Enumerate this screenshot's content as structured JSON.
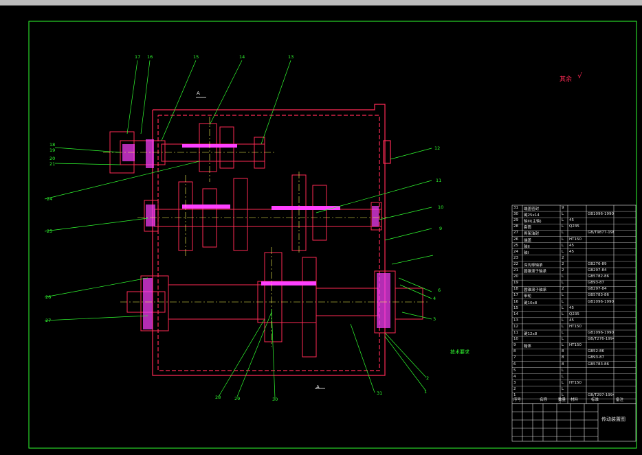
{
  "drawing": {
    "title_cn": "传动装置图",
    "roughness_label": "其余",
    "roughness_symbol": "√",
    "section_label_a_top": "A",
    "section_label_a_bottom": "A",
    "notes_title": "技术要求"
  },
  "callouts": [
    "17",
    "16",
    "15",
    "14",
    "13",
    "12",
    "11",
    "10",
    "9",
    "8",
    "7",
    "6",
    "5",
    "4",
    "3",
    "2",
    "1",
    "18",
    "19",
    "20",
    "21",
    "22",
    "23",
    "24",
    "25",
    "26",
    "27",
    "28",
    "29",
    "30"
  ],
  "table": {
    "headers": [
      "序号",
      "名称",
      "数量",
      "材料",
      "标准",
      "备注"
    ],
    "rows": [
      {
        "no": "31",
        "name": "端盖密封",
        "qty": "9",
        "mat": "",
        "std": ""
      },
      {
        "no": "30",
        "name": "键25x14",
        "qty": "L",
        "mat": "",
        "std": "GB1096-1990"
      },
      {
        "no": "29",
        "name": "轴III(主轴)",
        "qty": "L",
        "mat": "45",
        "std": ""
      },
      {
        "no": "28",
        "name": "套筒",
        "qty": "L",
        "mat": "Q235",
        "std": ""
      },
      {
        "no": "27",
        "name": "骨架油封",
        "qty": "L",
        "mat": "",
        "std": "GB/T9877-1988"
      },
      {
        "no": "26",
        "name": "端盖",
        "qty": "L",
        "mat": "HT150",
        "std": ""
      },
      {
        "no": "25",
        "name": "轴II",
        "qty": "L",
        "mat": "45",
        "std": ""
      },
      {
        "no": "24",
        "name": "轴I",
        "qty": "L",
        "mat": "45",
        "std": ""
      },
      {
        "no": "23",
        "name": "",
        "qty": "2",
        "mat": "",
        "std": ""
      },
      {
        "no": "22",
        "name": "深沟球轴承",
        "qty": "2",
        "mat": "",
        "std": "GB276-89"
      },
      {
        "no": "21",
        "name": "圆锥滚子轴承",
        "qty": "2",
        "mat": "",
        "std": "GB297-84"
      },
      {
        "no": "20",
        "name": "",
        "qty": "L",
        "mat": "",
        "std": "GB5782-86"
      },
      {
        "no": "19",
        "name": "",
        "qty": "L",
        "mat": "",
        "std": "GB93-87"
      },
      {
        "no": "18",
        "name": "圆锥滚子轴承",
        "qty": "2",
        "mat": "",
        "std": "GB297-84"
      },
      {
        "no": "17",
        "name": "带轮",
        "qty": "L",
        "mat": "",
        "std": "GB5783-86"
      },
      {
        "no": "16",
        "name": "键10x8",
        "qty": "L",
        "mat": "",
        "std": "GB1096-1990"
      },
      {
        "no": "15",
        "name": "",
        "qty": "L",
        "mat": "45",
        "std": ""
      },
      {
        "no": "14",
        "name": "",
        "qty": "L",
        "mat": "Q235",
        "std": ""
      },
      {
        "no": "13",
        "name": "",
        "qty": "L",
        "mat": "45",
        "std": ""
      },
      {
        "no": "12",
        "name": "",
        "qty": "L",
        "mat": "HT150",
        "std": ""
      },
      {
        "no": "11",
        "name": "键12x8",
        "qty": "L",
        "mat": "",
        "std": "GB1096-1990"
      },
      {
        "no": "10",
        "name": "",
        "qty": "L",
        "mat": "",
        "std": "GB/T276-1994"
      },
      {
        "no": "9",
        "name": "箱体",
        "qty": "L",
        "mat": "HT150",
        "std": ""
      },
      {
        "no": "8",
        "name": "",
        "qty": "8",
        "mat": "",
        "std": "GB52-86"
      },
      {
        "no": "7",
        "name": "",
        "qty": "8",
        "mat": "",
        "std": "GB93-87"
      },
      {
        "no": "6",
        "name": "",
        "qty": "8",
        "mat": "",
        "std": "GB5783-86"
      },
      {
        "no": "5",
        "name": "",
        "qty": "L",
        "mat": "",
        "std": ""
      },
      {
        "no": "4",
        "name": "",
        "qty": "L",
        "mat": "",
        "std": ""
      },
      {
        "no": "3",
        "name": "",
        "qty": "L",
        "mat": "HT150",
        "std": ""
      },
      {
        "no": "2",
        "name": "",
        "qty": "L",
        "mat": "",
        "std": ""
      },
      {
        "no": "1",
        "name": "",
        "qty": "L",
        "mat": "",
        "std": "GB/T297-1994"
      }
    ]
  },
  "colors": {
    "frame": "#31ff31",
    "part": "#ff2a55",
    "hatch": "#ff40ff",
    "center": "#ffff55",
    "text": "#e6e6e6",
    "blue": "#3a5bff",
    "cyan": "#00ffff"
  }
}
